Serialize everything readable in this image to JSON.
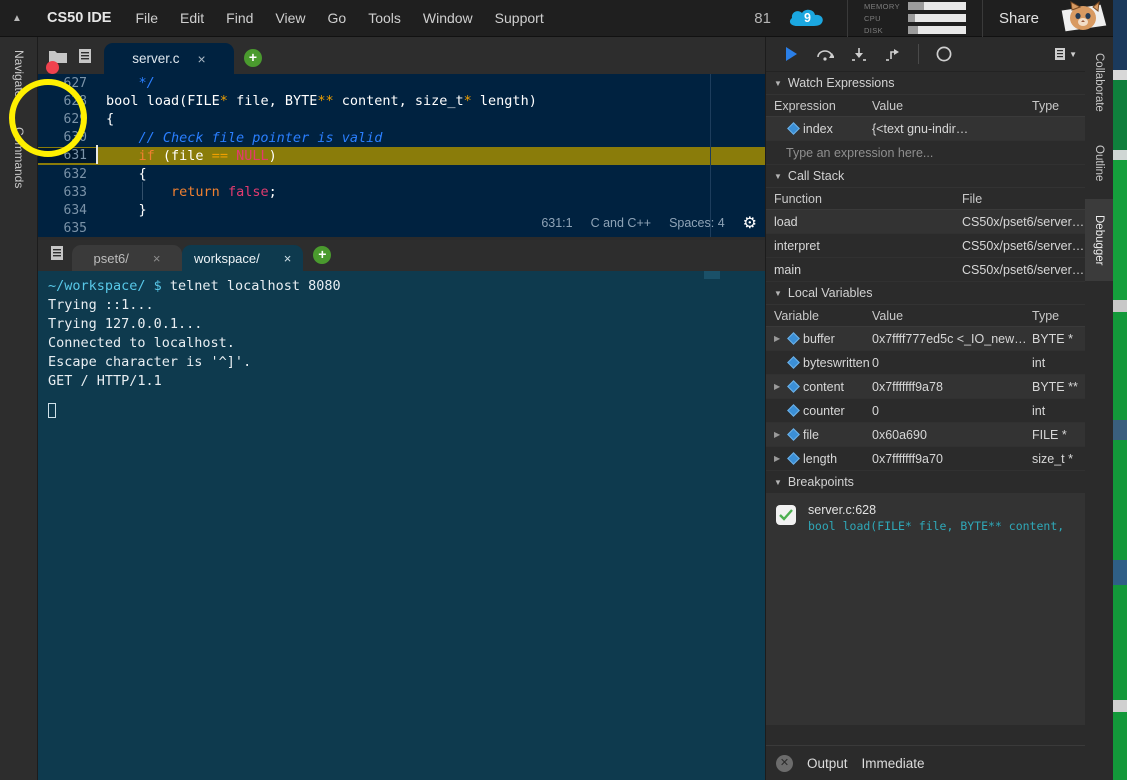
{
  "menubar": {
    "caret_icon": "triangle-up-icon",
    "brand": "CS50 IDE",
    "items": [
      "File",
      "Edit",
      "Find",
      "View",
      "Go",
      "Tools",
      "Window",
      "Support"
    ],
    "count": "81",
    "cloud_badge": "9",
    "meters": [
      {
        "label": "MEMORY",
        "fill_pct": 28
      },
      {
        "label": "CPU",
        "fill_pct": 12
      },
      {
        "label": "DISK",
        "fill_pct": 18
      }
    ],
    "share_label": "Share",
    "avatar": "cat-avatar"
  },
  "left_rail": {
    "tabs": [
      "Navigate",
      "Commands"
    ]
  },
  "right_rail": {
    "tabs": [
      "Collaborate",
      "Outline",
      "Debugger"
    ],
    "active": "Debugger"
  },
  "editor": {
    "toolbar_icons": [
      "folder-icon",
      "file-list-icon"
    ],
    "tab": {
      "label": "server.c",
      "close": "×"
    },
    "add_tab": "+",
    "lines": [
      {
        "num": "627",
        "active": false,
        "segments": [
          {
            "t": "    */",
            "c": "cmt"
          }
        ]
      },
      {
        "num": "628",
        "active": false,
        "breakpoint": true,
        "segments": [
          {
            "t": "bool load(FILE",
            "c": "kw"
          },
          {
            "t": "*",
            "c": "ast"
          },
          {
            "t": " file, BYTE",
            "c": "kw"
          },
          {
            "t": "**",
            "c": "ast"
          },
          {
            "t": " content, size_t",
            "c": "kw"
          },
          {
            "t": "*",
            "c": "ast"
          },
          {
            "t": " length)",
            "c": "kw"
          }
        ]
      },
      {
        "num": "629",
        "active": false,
        "segments": [
          {
            "t": "{",
            "c": "kw"
          }
        ]
      },
      {
        "num": "630",
        "active": false,
        "segments": [
          {
            "t": "    // Check file pointer is valid",
            "c": "cmt"
          }
        ]
      },
      {
        "num": "631",
        "active": true,
        "segments": [
          {
            "t": "    ",
            "c": "kw"
          },
          {
            "t": "if",
            "c": "ctl"
          },
          {
            "t": " (file ",
            "c": "kw"
          },
          {
            "t": "==",
            "c": "op"
          },
          {
            "t": " ",
            "c": "kw"
          },
          {
            "t": "NULL",
            "c": "str"
          },
          {
            "t": ")",
            "c": "kw"
          }
        ]
      },
      {
        "num": "632",
        "active": false,
        "segments": [
          {
            "t": "    {",
            "c": "kw"
          }
        ]
      },
      {
        "num": "633",
        "active": false,
        "segments": [
          {
            "t": "        ",
            "c": "kw"
          },
          {
            "t": "return",
            "c": "ctl"
          },
          {
            "t": " ",
            "c": "kw"
          },
          {
            "t": "false",
            "c": "str"
          },
          {
            "t": ";",
            "c": "kw"
          }
        ]
      },
      {
        "num": "634",
        "active": false,
        "segments": [
          {
            "t": "    }",
            "c": "kw"
          }
        ]
      },
      {
        "num": "635",
        "active": false,
        "segments": [
          {
            "t": "",
            "c": "kw"
          }
        ]
      }
    ],
    "status": {
      "position": "631:1",
      "language": "C and C++",
      "indent": "Spaces: 4",
      "gear_icon": "gear-icon"
    }
  },
  "terminal": {
    "toolbar_icon": "file-list-icon",
    "tabs": [
      {
        "label": "pset6/",
        "active": false,
        "close": "×"
      },
      {
        "label": "workspace/",
        "active": true,
        "close": "×"
      }
    ],
    "add_tab": "+",
    "prompt": "~/workspace/ $",
    "command": " telnet localhost 8080",
    "output": [
      "Trying ::1...",
      "Trying 127.0.0.1...",
      "Connected to localhost.",
      "Escape character is '^]'.",
      "GET / HTTP/1.1"
    ]
  },
  "debugger": {
    "toolbar": {
      "resume": "resume-icon",
      "step_over": "step-over-icon",
      "step_into": "step-into-icon",
      "step_out": "step-out-icon",
      "suspend": "suspend-icon",
      "menu": "panel-menu-icon"
    },
    "watch": {
      "title": "Watch Expressions",
      "columns": [
        "Expression",
        "Value",
        "Type"
      ],
      "rows": [
        {
          "expression": "index",
          "value": "{<text gnu-indir…",
          "type": ""
        }
      ],
      "placeholder": "Type an expression here..."
    },
    "call_stack": {
      "title": "Call Stack",
      "columns": [
        "Function",
        "File"
      ],
      "rows": [
        {
          "function": "load",
          "file": "CS50x/pset6/server…"
        },
        {
          "function": "interpret",
          "file": "CS50x/pset6/server…"
        },
        {
          "function": "main",
          "file": "CS50x/pset6/server…"
        }
      ]
    },
    "locals": {
      "title": "Local Variables",
      "columns": [
        "Variable",
        "Value",
        "Type"
      ],
      "rows": [
        {
          "variable": "buffer",
          "value": "0x7ffff777ed5c <_IO_new…",
          "type": "BYTE *",
          "expandable": true
        },
        {
          "variable": "byteswritten",
          "value": "0",
          "type": "int",
          "expandable": false
        },
        {
          "variable": "content",
          "value": "0x7fffffff9a78",
          "type": "BYTE **",
          "expandable": true
        },
        {
          "variable": "counter",
          "value": "0",
          "type": "int",
          "expandable": false
        },
        {
          "variable": "file",
          "value": "0x60a690",
          "type": "FILE *",
          "expandable": true
        },
        {
          "variable": "length",
          "value": "0x7fffffff9a70",
          "type": "size_t *",
          "expandable": true
        }
      ]
    },
    "breakpoints": {
      "title": "Breakpoints",
      "items": [
        {
          "checked": true,
          "location": "server.c:628",
          "code": "bool load(FILE* file, BYTE** content, size…"
        }
      ]
    },
    "bottom": {
      "close_icon": "close-circle-icon",
      "tabs": [
        "Output",
        "Immediate"
      ]
    }
  },
  "annotation": {
    "type": "highlight-circle",
    "color": "#fff000",
    "target": "breakpoint-dot-line-628"
  }
}
